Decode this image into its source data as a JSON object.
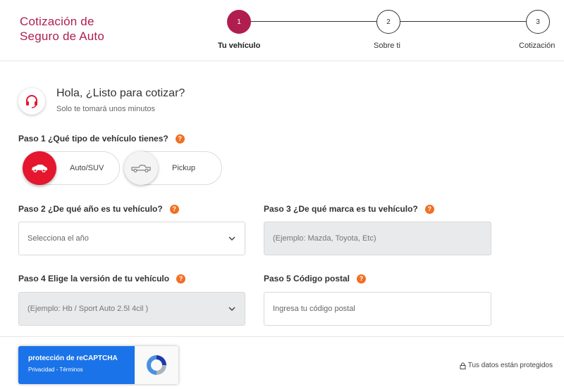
{
  "header": {
    "brand_line1": "Cotización de",
    "brand_line2": "Seguro de Auto",
    "steps": [
      {
        "number": "1",
        "label": "Tu vehículo",
        "active": true
      },
      {
        "number": "2",
        "label": "Sobre ti",
        "active": false
      },
      {
        "number": "3",
        "label": "Cotización",
        "active": false
      }
    ]
  },
  "greeting": {
    "icon": "headset-icon",
    "title": "Hola, ¿Listo para cotizar?",
    "subtitle": "Solo te tomará unos minutos"
  },
  "step1": {
    "label": "Paso 1 ¿Qué tipo de vehículo tienes?",
    "options": [
      {
        "label": "Auto/SUV",
        "icon": "car-icon",
        "selected": true
      },
      {
        "label": "Pickup",
        "icon": "pickup-truck-icon",
        "selected": false
      }
    ]
  },
  "step2": {
    "label": "Paso 2 ¿De qué año es tu vehículo?",
    "placeholder": "Selecciona el año"
  },
  "step3": {
    "label": "Paso 3 ¿De qué marca es tu vehículo?",
    "placeholder": "(Ejemplo: Mazda, Toyota, Etc)"
  },
  "step4": {
    "label": "Paso 4 Elige la versión de tu vehículo",
    "placeholder": "(Ejemplo: Hb / Sport Auto 2.5l 4cil )"
  },
  "step5": {
    "label": "Paso 5 Código postal",
    "placeholder": "Ingresa tu código postal"
  },
  "help_glyph": "?",
  "recaptcha": {
    "title": "protección de reCAPTCHA",
    "links": "Privacidad - Términos"
  },
  "footer": {
    "protected_text": "Tus datos están protegidos"
  },
  "colors": {
    "brand": "#b01e4f",
    "selected_vehicle": "#e4172f",
    "help": "#f26f21",
    "recaptcha_blue": "#1a73e8"
  }
}
